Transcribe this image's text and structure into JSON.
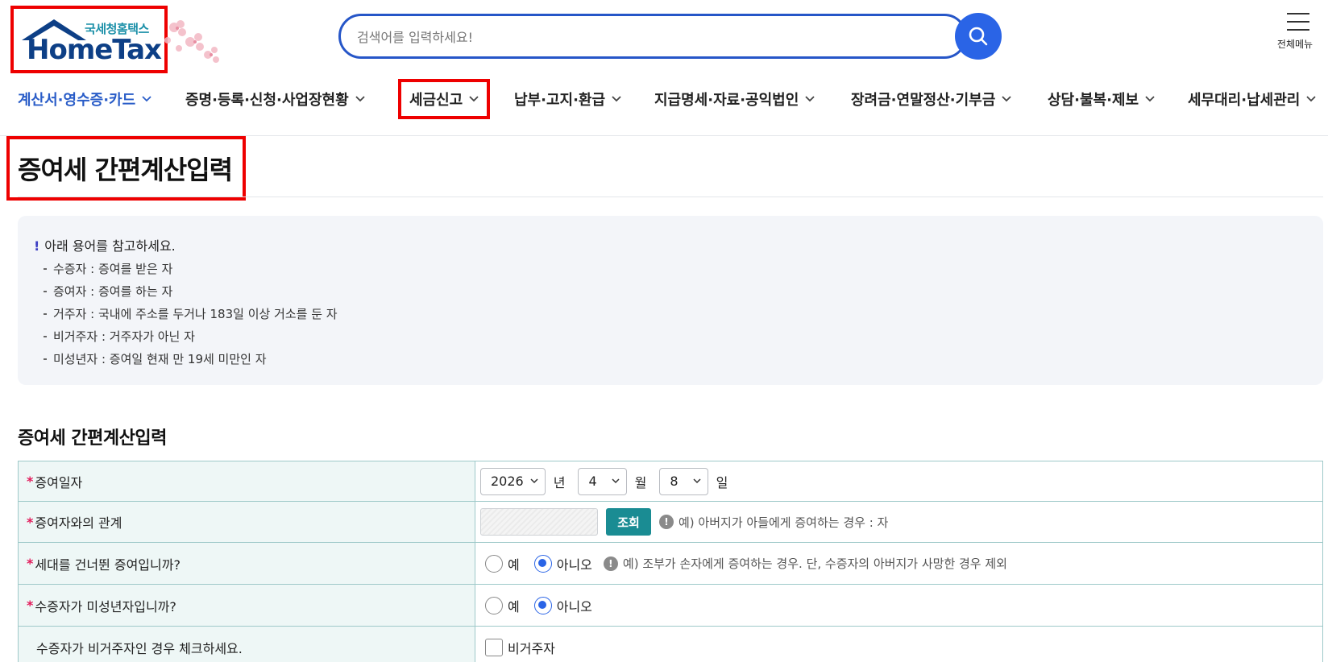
{
  "header": {
    "logo_sub": "국세청홈택스",
    "logo_main": "HomeTax",
    "search_placeholder": "검색어를 입력하세요!",
    "all_menu_label": "전체메뉴"
  },
  "nav": {
    "items": [
      {
        "label": "계산서·영수증·카드"
      },
      {
        "label": "증명·등록·신청·사업장현황"
      },
      {
        "label": "세금신고"
      },
      {
        "label": "납부·고지·환급"
      },
      {
        "label": "지급명세·자료·공익법인"
      },
      {
        "label": "장려금·연말정산·기부금"
      },
      {
        "label": "상담·불복·제보"
      },
      {
        "label": "세무대리·납세관리"
      }
    ]
  },
  "page": {
    "title": "증여세 간편계산입력"
  },
  "notice": {
    "heading": "아래 용어를 참고하세요.",
    "items": [
      "수증자 : 증여를 받은 자",
      "증여자 : 증여를 하는 자",
      "거주자 : 국내에 주소를 두거나 183일 이상 거소를 둔 자",
      "비거주자 : 거주자가 아닌 자",
      "미성년자 : 증여일 현재 만 19세 미만인 자"
    ]
  },
  "form": {
    "section_title": "증여세 간편계산입력",
    "required_mark": "*",
    "date": {
      "label": "증여일자",
      "year": "2026",
      "year_unit": "년",
      "month": "4",
      "month_unit": "월",
      "day": "8",
      "day_unit": "일"
    },
    "relation": {
      "label": "증여자와의 관계",
      "lookup_button": "조회",
      "hint": "예) 아버지가 아들에게 증여하는 경우 : 자"
    },
    "skip_generation": {
      "label": "세대를 건너뛴 증여입니까?",
      "yes": "예",
      "no": "아니오",
      "hint": "예) 조부가 손자에게 증여하는 경우. 단, 수증자의 아버지가 사망한 경우 제외"
    },
    "minor": {
      "label": "수증자가 미성년자입니까?",
      "yes": "예",
      "no": "아니오"
    },
    "nonresident": {
      "label": "수증자가 비거주자인 경우 체크하세요.",
      "checkbox_label": "비거주자"
    }
  },
  "colors": {
    "accent_blue": "#2a64e6",
    "nav_active": "#2a5dc8",
    "highlight_red": "#e00000",
    "teal_button": "#1a8c93",
    "required_mark": "#e21a5a",
    "label_bg": "#eef7f6"
  }
}
